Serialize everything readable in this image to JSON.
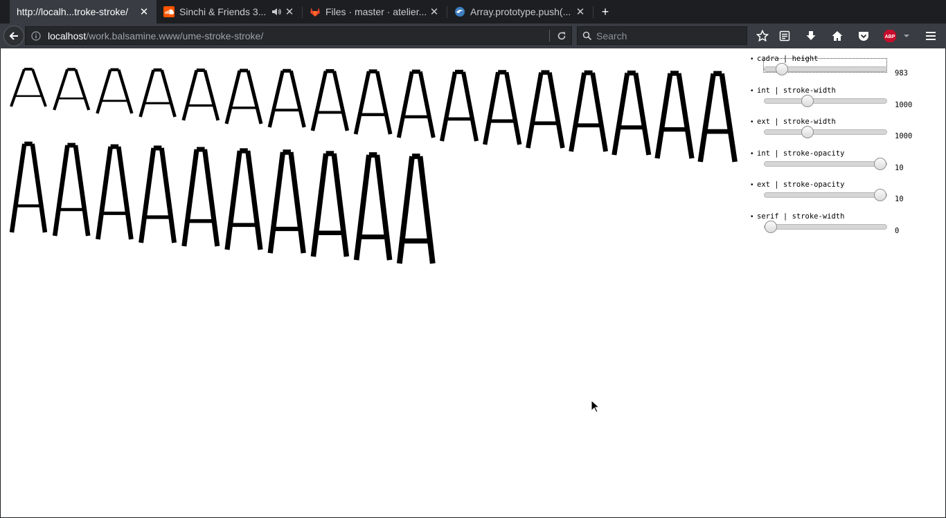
{
  "tabs": [
    {
      "title": "http://localh...troke-stroke/",
      "active": true,
      "favicon": "none"
    },
    {
      "title": "Sinchi & Friends 3...",
      "active": false,
      "favicon": "soundcloud-icon",
      "audio": true
    },
    {
      "title": "Files · master · atelier...",
      "active": false,
      "favicon": "gitlab-icon"
    },
    {
      "title": "Array.prototype.push(...",
      "active": false,
      "favicon": "mdn-icon"
    }
  ],
  "navbar": {
    "url_host": "localhost",
    "url_path": "/work.balsamine.www/ume-stroke-stroke/",
    "search_placeholder": "Search"
  },
  "specimen": {
    "glyph": "A",
    "row1_count": 17,
    "row2_count": 10
  },
  "controls": [
    {
      "label": "cadra | height",
      "value": "983",
      "fill": 0.14,
      "focused": true
    },
    {
      "label": "int | stroke-width",
      "value": "1000",
      "fill": 0.35,
      "focused": false
    },
    {
      "label": "ext | stroke-width",
      "value": "1000",
      "fill": 0.35,
      "focused": false
    },
    {
      "label": "int | stroke-opacity",
      "value": "10",
      "fill": 0.95,
      "focused": false
    },
    {
      "label": "ext | stroke-opacity",
      "value": "10",
      "fill": 0.95,
      "focused": false
    },
    {
      "label": "serif | stroke-width",
      "value": "0",
      "fill": 0.05,
      "focused": false
    }
  ],
  "colors": {
    "tabbar_bg": "#1c1e21",
    "active_tab_bg": "#393c42",
    "glyph_color": "#000000",
    "soundcloud": "#ff5500",
    "gitlab": "#e24329",
    "abp": "#c70d2c"
  }
}
